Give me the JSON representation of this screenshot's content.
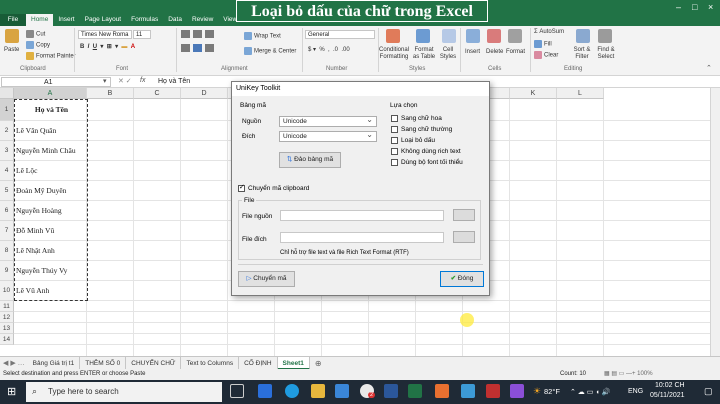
{
  "banner": "Loại bỏ dấu của chữ trong Excel",
  "ribbon_tabs": [
    "File",
    "Home",
    "Insert",
    "Page Layout",
    "Formulas",
    "Data",
    "Review",
    "View"
  ],
  "ribbon": {
    "paste": "Paste",
    "cut": "Cut",
    "copy": "Copy",
    "format_painter": "Format Painter",
    "clipboard": "Clipboard",
    "font_name": "Times New Roma",
    "font_size": "11",
    "font": "Font",
    "wrap_text": "Wrap Text",
    "merge_center": "Merge & Center",
    "alignment": "Alignment",
    "number_format": "General",
    "number": "Number",
    "conditional": "Conditional Formatting",
    "format_table": "Format as Table",
    "cell_styles": "Cell Styles",
    "styles": "Styles",
    "insert": "Insert",
    "delete": "Delete",
    "format": "Format",
    "cells": "Cells",
    "autosum": "AutoSum",
    "fill": "Fill",
    "clear": "Clear",
    "sort_filter": "Sort & Filter",
    "find_select": "Find & Select",
    "editing": "Editing"
  },
  "formula_bar": {
    "name_box": "A1",
    "fx": "fx",
    "value": "Họ và Tên"
  },
  "columns": [
    "A",
    "B",
    "C",
    "D",
    "E",
    "F",
    "G",
    "H",
    "I",
    "J",
    "K",
    "L"
  ],
  "rows": [
    "1",
    "2",
    "3",
    "4",
    "5",
    "6",
    "7",
    "8",
    "9",
    "10",
    "11",
    "12",
    "13",
    "14"
  ],
  "cells": [
    "Họ và Tên",
    "Lê Văn Quân",
    "Nguyễn Minh Châu",
    "Lê Lộc",
    "Đoàn Mỹ Duyên",
    "Nguyễn Hoàng",
    "Đỗ Minh Vũ",
    "Lê Nhật Anh",
    "Nguyễn Thúy Vy",
    "Lê Vũ Anh"
  ],
  "sheet_tabs": [
    "Bảng Giá trị t1",
    "THÊM SỐ 0",
    "CHUYỂN CHỮ",
    "Text to Columns",
    "CỐ ĐỊNH",
    "Sheet1"
  ],
  "active_sheet": "Sheet1",
  "status": {
    "left": "Select destination and press ENTER or choose Paste",
    "count": "Count: 10"
  },
  "dialog": {
    "title": "UniKey Toolkit",
    "encoding_group": "Bảng mã",
    "source_label": "Nguồn",
    "source_value": "Unicode",
    "dest_label": "Đích",
    "dest_value": "Unicode",
    "swap_button": "Đảo bảng mã",
    "options_group": "Lựa chọn",
    "options": [
      {
        "label": "Sang chữ hoa",
        "checked": false
      },
      {
        "label": "Sang chữ thường",
        "checked": false
      },
      {
        "label": "Loại bỏ dấu",
        "checked": false
      },
      {
        "label": "Không dùng rich text",
        "checked": false
      },
      {
        "label": "Dùng bộ font tối thiểu",
        "checked": false
      }
    ],
    "clipboard_label": "Chuyển mã clipboard",
    "clipboard_checked": true,
    "file_group": "File",
    "file_source": "File nguồn",
    "file_dest": "File đích",
    "note": "Chỉ hỗ trợ file text và file Rich Text Format (RTF)",
    "convert_button": "Chuyển mã",
    "close_button": "Đóng"
  },
  "taskbar": {
    "search": "Type here to search",
    "temp": "82°F",
    "lang": "ENG",
    "time": "10:02 CH",
    "date": "05/11/2021",
    "badge": "2"
  },
  "colors": {
    "excel_green": "#217346",
    "taskbar": "#1f2a36"
  }
}
